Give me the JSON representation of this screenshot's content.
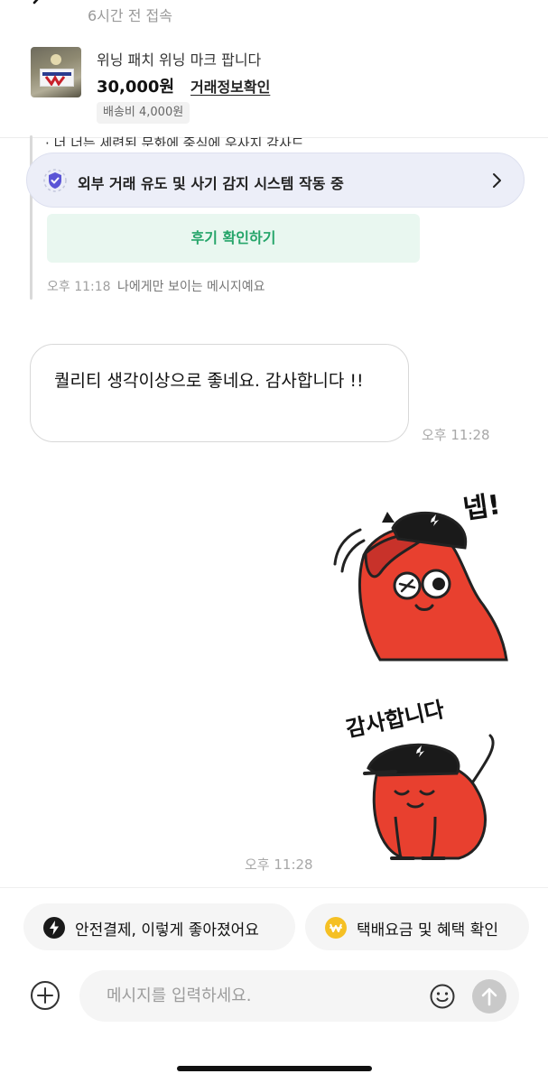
{
  "header": {
    "status": "6시간 전 접속"
  },
  "product": {
    "title": "위닝 패치 위닝 마크 팝니다",
    "price": "30,000원",
    "trade_info_link": "거래정보확인",
    "shipping": "배송비 4,000원"
  },
  "chat": {
    "clipped_previous_text": "· 너 너는 세련된 문화에 중심에 우사지 감사드",
    "fraud_banner": "외부 거래 유도 및 사기 감지 시스템 작동 중",
    "review_button": "후기 확인하기",
    "system_time": "오후 11:18",
    "system_note": "나에게만 보이는 메시지예요",
    "received_message": "퀄리티 생각이상으로 좋네요. 감사합니다 !!",
    "received_time": "오후 11:28",
    "sticker1_text": "넵!",
    "sticker2_text": "감사합니다",
    "sticker_time": "오후 11:28"
  },
  "chips": {
    "safe_payment": "안전결제, 이렇게 좋아졌어요",
    "delivery": "택배요금 및 혜택 확인"
  },
  "composer": {
    "placeholder": "메시지를 입력하세요."
  },
  "colors": {
    "accent_green": "#25a56a",
    "banner_bg": "#eceef8",
    "shield_purple": "#5b55d6",
    "sticker_red": "#e8402f",
    "chip_gold": "#f5c024"
  },
  "icons": [
    "back-chevron-icon",
    "more-icon",
    "shield-check-icon",
    "chevron-right-icon",
    "lightning-icon",
    "won-coin-icon",
    "plus-circle-icon",
    "smile-icon",
    "arrow-up-icon"
  ]
}
